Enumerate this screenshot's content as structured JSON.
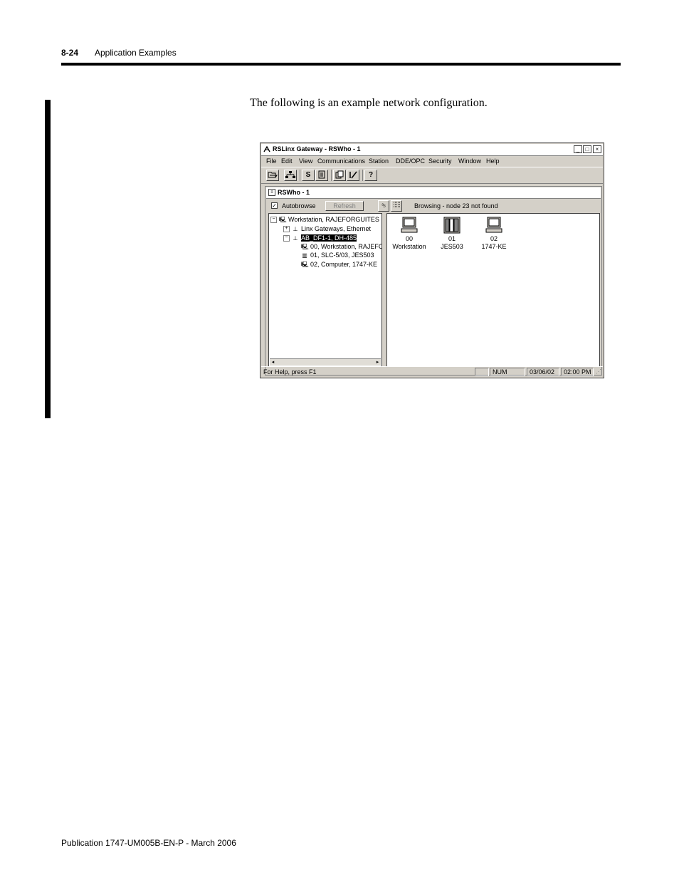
{
  "page_header": {
    "page_number": "8-24",
    "section_title": "Application Examples"
  },
  "intro_text": "The following is an example network configuration.",
  "footer": "Publication 1747-UM005B-EN-P - March 2006",
  "screenshot": {
    "window_title": "RSLinx Gateway - RSWho - 1",
    "window_buttons": {
      "minimize": "_",
      "maximize": "□",
      "close": "×"
    },
    "menu": [
      "File",
      "Edit",
      "View",
      "Communications",
      "Station",
      "DDE/OPC",
      "Security",
      "Window",
      "Help"
    ],
    "toolbar_icons": [
      "open-icon",
      "network-icon",
      "station-icon",
      "configure-icon",
      "copy-icon",
      "edit-icon",
      "help-icon"
    ],
    "child_window_title": "RSWho - 1",
    "autobrowse_label": "Autobrowse",
    "autobrowse_checked": "✓",
    "refresh_label": "Refresh",
    "browse_status": "Browsing - node 23 not found",
    "tree": {
      "workstation": "Workstation, RAJEFORGUITES",
      "linx_gateways": "Linx Gateways, Ethernet",
      "ab_df1": "AB_DF1-1, DH-485",
      "node_00": "00, Workstation, RAJEFC",
      "node_01": "01, SLC-5/03, JES503",
      "node_02": "02, Computer, 1747-KE"
    },
    "devices": [
      {
        "number": "00",
        "name": "Workstation",
        "icon": "computer-icon"
      },
      {
        "number": "01",
        "name": "JES503",
        "icon": "plc-icon"
      },
      {
        "number": "02",
        "name": "1747-KE",
        "icon": "computer-icon"
      }
    ],
    "statusbar": {
      "help": "For Help, press F1",
      "num": "NUM",
      "date": "03/06/02",
      "time": "02:00 PM"
    }
  }
}
